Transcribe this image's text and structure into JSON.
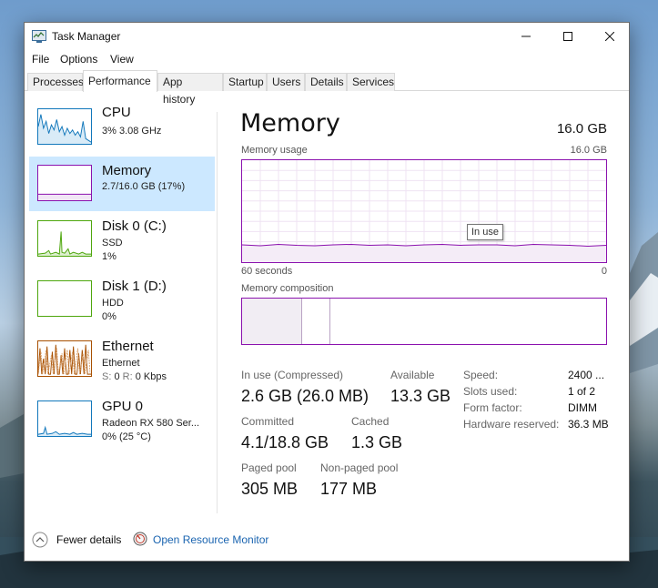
{
  "window": {
    "title": "Task Manager"
  },
  "menu": [
    "File",
    "Options",
    "View"
  ],
  "tabs": [
    {
      "label": "Processes"
    },
    {
      "label": "Performance",
      "active": true
    },
    {
      "label": "App history"
    },
    {
      "label": "Startup"
    },
    {
      "label": "Users"
    },
    {
      "label": "Details"
    },
    {
      "label": "Services"
    }
  ],
  "sidebar": {
    "cpu": {
      "title": "CPU",
      "sub": "3% 3.08 GHz",
      "color": "#1177bb"
    },
    "memory": {
      "title": "Memory",
      "sub": "2.7/16.0 GB (17%)",
      "color": "#8b12ae"
    },
    "disk0": {
      "title": "Disk 0 (C:)",
      "sub1": "SSD",
      "sub2": "1%",
      "color": "#4da60c"
    },
    "disk1": {
      "title": "Disk 1 (D:)",
      "sub1": "HDD",
      "sub2": "0%",
      "color": "#4da60c"
    },
    "ethernet": {
      "title": "Ethernet",
      "sub1": "Ethernet",
      "sub2_label": "S:",
      "sub2_send": "0",
      "sub2_recv_label": "R:",
      "sub2_recv": "0 Kbps",
      "color": "#a74f01"
    },
    "gpu": {
      "title": "GPU 0",
      "sub1": "Radeon RX 580 Ser...",
      "sub2": "0% (25 °C)",
      "color": "#1177bb"
    }
  },
  "main": {
    "title": "Memory",
    "total": "16.0 GB",
    "usage_label": "Memory usage",
    "usage_max": "16.0 GB",
    "axis_left": "60 seconds",
    "axis_right": "0",
    "tooltip": "In use",
    "composition_label": "Memory composition",
    "usage_fraction": 0.17,
    "in_use_label": "In use (Compressed)",
    "in_use_value": "2.6 GB (26.0 MB)",
    "available_label": "Available",
    "available_value": "13.3 GB",
    "committed_label": "Committed",
    "committed_value": "4.1/18.8 GB",
    "cached_label": "Cached",
    "cached_value": "1.3 GB",
    "paged_label": "Paged pool",
    "paged_value": "305 MB",
    "nonpaged_label": "Non-paged pool",
    "nonpaged_value": "177 MB",
    "specs": [
      {
        "label": "Speed:",
        "value": "2400 ..."
      },
      {
        "label": "Slots used:",
        "value": "1 of 2"
      },
      {
        "label": "Form factor:",
        "value": "DIMM"
      },
      {
        "label": "Hardware reserved:",
        "value": "36.3 MB"
      }
    ]
  },
  "footer": {
    "fewer": "Fewer details",
    "resource_monitor": "Open Resource Monitor"
  },
  "colors": {
    "memory_accent": "#8b12ae",
    "link": "#1a64b0",
    "selected_bg": "#cce8ff"
  }
}
